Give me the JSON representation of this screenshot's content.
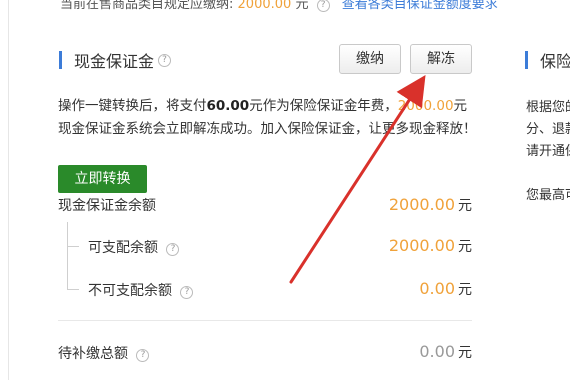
{
  "top_line": {
    "text": "当前在售商品类目规定应缴纳:",
    "amount": "2000.00",
    "unit": "元",
    "link": "查看各类目保证金额度要求"
  },
  "cash_deposit": {
    "title": "现金保证金",
    "pay_button": "缴纳",
    "unfreeze_button": "解冻",
    "description_part1": "操作一键转换后，将支付",
    "description_bold": "60.00",
    "description_part2": "元作为保险保证金年费，",
    "description_amount": "2000.00",
    "description_part3": "元现金保证金系统会立即解冻成功。加入保险保证金，让更多现金释放！",
    "convert_button": "立即转换",
    "balance_label": "现金保证金余额",
    "balance_value": "2000.00",
    "available_label": "可支配余额",
    "available_value": "2000.00",
    "unavailable_label": "不可支配余额",
    "unavailable_value": "0.00",
    "pending_label": "待补缴总额",
    "pending_value": "0.00",
    "unit": "元"
  },
  "right_panel": {
    "title": "保险",
    "line1": "根据您的",
    "line2": "分、退款",
    "line3": "请开通保",
    "line4": "您最高可"
  },
  "colors": {
    "accent_blue": "#3c7cd8",
    "amount_orange": "#f0a23a",
    "convert_green": "#2a8a2a",
    "arrow_red": "#d9312b"
  }
}
